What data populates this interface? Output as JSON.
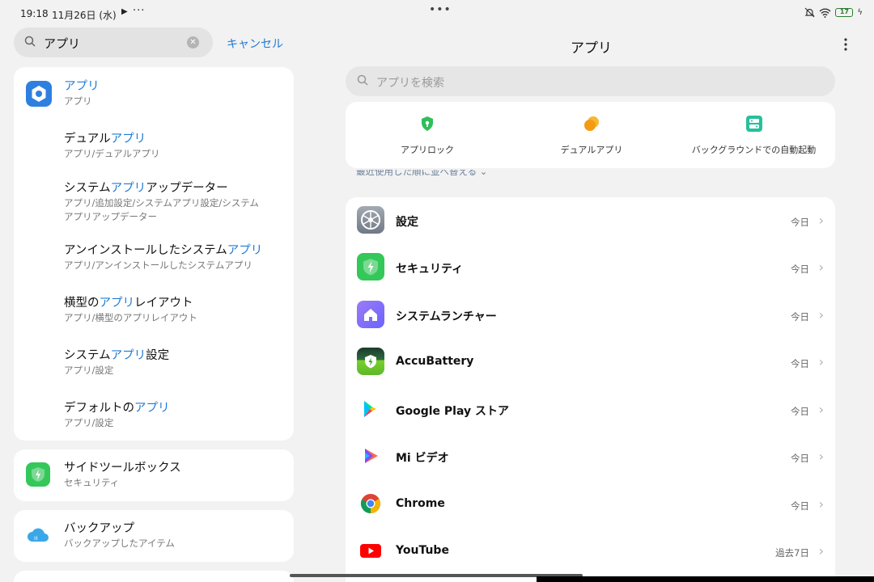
{
  "status": {
    "time": "19:18",
    "date": "11月26日 (水)",
    "battery": "17"
  },
  "left": {
    "search_query": "アプリ",
    "cancel_label": "キャンセル",
    "results": [
      {
        "pre": "",
        "hl": "アプリ",
        "post": "",
        "sub": "アプリ"
      },
      {
        "pre": "デュアル",
        "hl": "アプリ",
        "post": "",
        "sub": "アプリ/デュアルアプリ"
      },
      {
        "pre": "システム",
        "hl": "アプリ",
        "post": "アップデーター",
        "sub": "アプリ/追加設定/システムアプリ設定/システム",
        "sub2": "アプリアップデーター"
      },
      {
        "pre": "アンインストールしたシステム",
        "hl": "アプリ",
        "post": "",
        "sub": "アプリ/アンインストールしたシステムアプリ"
      },
      {
        "pre": "横型の",
        "hl": "アプリ",
        "post": "レイアウト",
        "sub": "アプリ/横型のアプリレイアウト"
      },
      {
        "pre": "システム",
        "hl": "アプリ",
        "post": "設定",
        "sub": "アプリ/設定"
      },
      {
        "pre": "デフォルトの",
        "hl": "アプリ",
        "post": "",
        "sub": "アプリ/設定"
      }
    ],
    "sidetool": {
      "title": "サイドツールボックス",
      "sub": "セキュリティ"
    },
    "backup": {
      "title": "バックアップ",
      "sub": "バックアップしたアイテム"
    }
  },
  "right": {
    "title": "アプリ",
    "search_placeholder": "アプリを検索",
    "quick": [
      {
        "label": "アプリロック",
        "icon": "shield-lock-icon"
      },
      {
        "label": "デュアルアプリ",
        "icon": "dual-app-icon"
      },
      {
        "label": "バックグラウンドでの自動起動",
        "icon": "autostart-icon"
      }
    ],
    "sort_note": "最近使用した順に並べ替える ⌄",
    "apps": [
      {
        "name": "設定",
        "when": "今日"
      },
      {
        "name": "セキュリティ",
        "when": "今日"
      },
      {
        "name": "システムランチャー",
        "when": "今日"
      },
      {
        "name": "AccuBattery",
        "when": "今日"
      },
      {
        "name": "Google Play ストア",
        "when": "今日"
      },
      {
        "name": "Mi ビデオ",
        "when": "今日"
      },
      {
        "name": "Chrome",
        "when": "今日"
      },
      {
        "name": "YouTube",
        "when": "過去7日"
      }
    ]
  },
  "colors": {
    "accent": "#1f7bd6",
    "background": "#f2f2f2",
    "card": "#ffffff"
  }
}
